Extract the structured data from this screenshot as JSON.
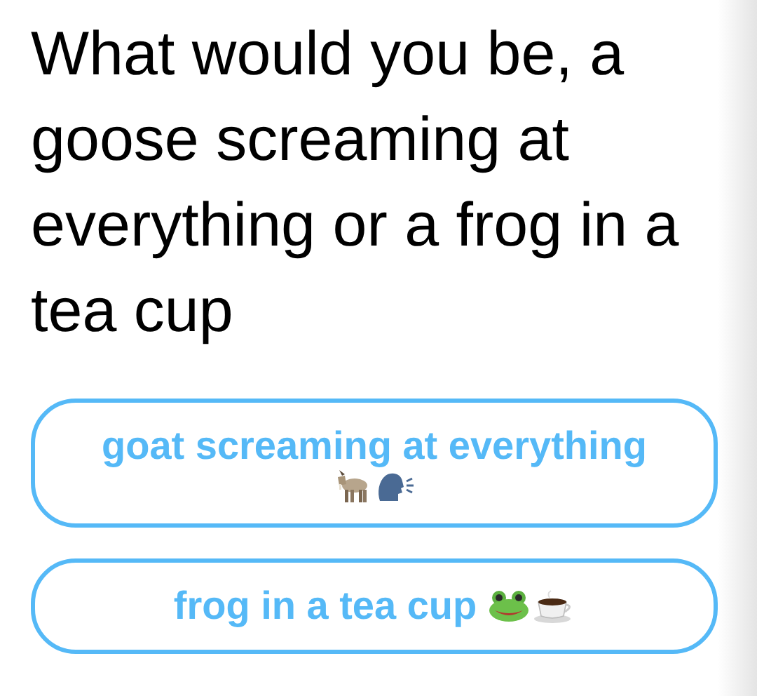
{
  "question": "What would you be, a goose screaming at everything or a frog in a tea cup",
  "options": [
    {
      "label": "goat screaming at everything"
    },
    {
      "label": "frog in a tea cup"
    }
  ]
}
